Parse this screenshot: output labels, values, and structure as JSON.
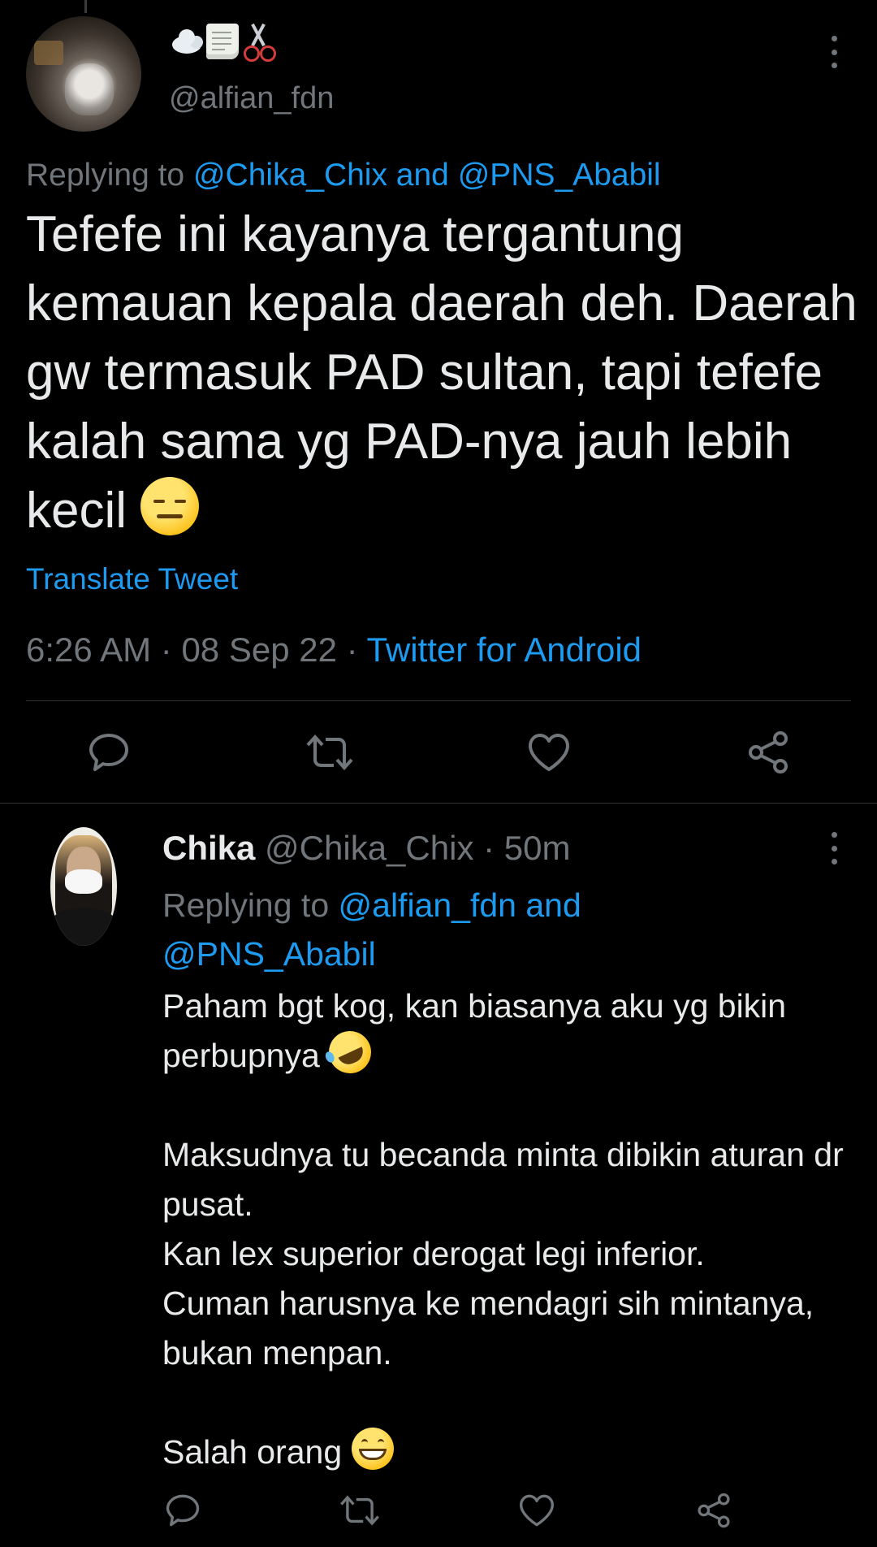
{
  "colors": {
    "background": "#000000",
    "text": "#e7e9ea",
    "muted": "#71767b",
    "link": "#1d9bf0",
    "divider": "#2f3336"
  },
  "main_tweet": {
    "display_name_emojis": [
      "cloud-emoji",
      "scroll-emoji",
      "scissors-emoji"
    ],
    "handle": "@alfian_fdn",
    "replying_prefix": "Replying to ",
    "replying_user1": "@Chika_Chix",
    "replying_and": " and ",
    "replying_user2": "@PNS_Ababil",
    "text": "Tefefe ini kayanya tergantung kemauan kepala daerah deh. Daerah gw termasuk PAD sultan, tapi tefefe kalah sama yg PAD-nya jauh lebih kecil ",
    "text_emoji": "expressionless-face-emoji",
    "translate_label": "Translate Tweet",
    "time": "6:26 AM",
    "sep1": " · ",
    "date": "08 Sep 22",
    "sep2": " · ",
    "source": "Twitter for Android",
    "actions": [
      "reply-icon",
      "retweet-icon",
      "like-icon",
      "share-icon"
    ]
  },
  "reply_tweet": {
    "name": "Chika",
    "handle": " @Chika_Chix",
    "sep": " · ",
    "age": "50m",
    "replying_prefix": "Replying to ",
    "replying_user1": "@alfian_fdn",
    "replying_and": " and",
    "replying_user2": "@PNS_Ababil",
    "line1": "Paham bgt kog, kan biasanya aku yg bikin perbupnya ",
    "line1_emoji": "rolling-on-floor-laughing-emoji",
    "line2": "Maksudnya tu becanda minta dibikin aturan dr pusat.",
    "line3": "Kan lex superior derogat legi inferior.",
    "line4": "Cuman harusnya ke mendagri sih mintanya, bukan menpan.",
    "line5": "Salah orang ",
    "line5_emoji": "grinning-face-emoji",
    "actions": [
      "reply-icon",
      "retweet-icon",
      "like-icon",
      "share-icon"
    ]
  }
}
